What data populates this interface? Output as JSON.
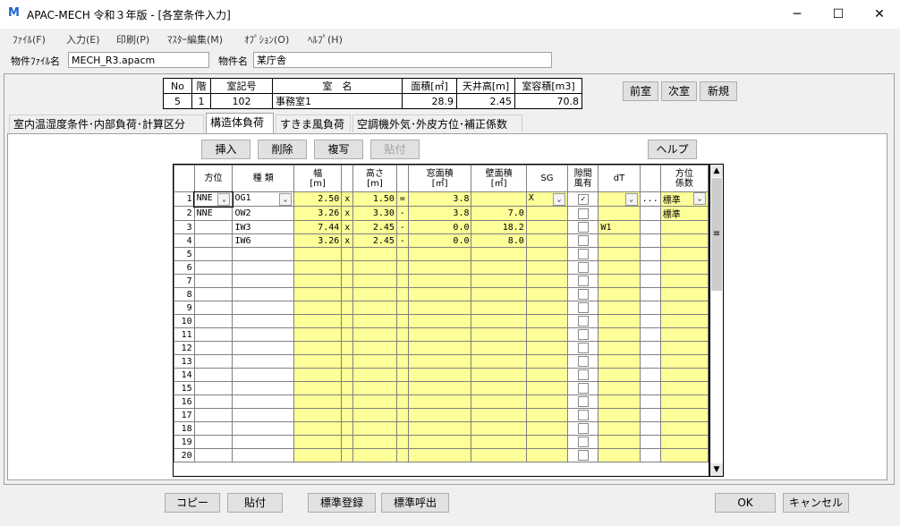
{
  "window": {
    "icon": "M",
    "title": "APAC-MECH 令和３年版 - [各室条件入力]",
    "minimize": "─",
    "maximize": "☐",
    "close": "✕"
  },
  "menu": [
    "ﾌｧｲﾙ(F)",
    "入力(E)",
    "印刷(P)",
    "ﾏｽﾀｰ編集(M)",
    "ｵﾌﾟｼｮﾝ(O)",
    "ﾍﾙﾌﾟ(H)"
  ],
  "file": {
    "file_label": "物件ﾌｧｲﾙ名",
    "file_value": "MECH_R3.apacm",
    "name_label": "物件名",
    "name_value": "某庁舎"
  },
  "room_info": {
    "headers": [
      "No",
      "階",
      "室記号",
      "室　名",
      "面積[㎡]",
      "天井高[m]",
      "室容積[m3]"
    ],
    "values": [
      "5",
      "1",
      "102",
      "事務室1",
      "28.9",
      "2.45",
      "70.8"
    ]
  },
  "room_buttons": {
    "prev": "前室",
    "next": "次室",
    "new": "新規"
  },
  "tabs": [
    "室内温湿度条件･内部負荷･計算区分",
    "構造体負荷",
    "すきま風負荷",
    "空調機外気･外皮方位･補正係数"
  ],
  "active_tab": 1,
  "edit_buttons": {
    "insert": "挿入",
    "delete": "削除",
    "copy": "複写",
    "paste": "貼付",
    "help": "ヘルプ"
  },
  "grid": {
    "headers": [
      "方位",
      "種 類",
      "幅\n[m]",
      "",
      "高さ\n[m]",
      "",
      "窓面積\n[㎡]",
      "壁面積\n[㎡]",
      "SG",
      "隙間\n風有",
      "dT",
      "",
      "方位\n係数"
    ],
    "rows": [
      {
        "no": "1",
        "dir": "NNE",
        "type": "OG1",
        "w": "2.50",
        "op1": "x",
        "h": "1.50",
        "op2": "=",
        "win": "3.8",
        "wall": "",
        "sg": "X",
        "gap": "✓",
        "dt": "",
        "dots": "...",
        "coef": "標準"
      },
      {
        "no": "2",
        "dir": "NNE",
        "type": "OW2",
        "w": "3.26",
        "op1": "x",
        "h": "3.30",
        "op2": "-",
        "win": "3.8",
        "wall": "7.0",
        "sg": "",
        "gap": "",
        "dt": "",
        "dots": "",
        "coef": "標準"
      },
      {
        "no": "3",
        "dir": "",
        "type": "IW3",
        "w": "7.44",
        "op1": "x",
        "h": "2.45",
        "op2": "-",
        "win": "0.0",
        "wall": "18.2",
        "sg": "",
        "gap": "",
        "dt": "W1",
        "dots": "",
        "coef": ""
      },
      {
        "no": "4",
        "dir": "",
        "type": "IW6",
        "w": "3.26",
        "op1": "x",
        "h": "2.45",
        "op2": "-",
        "win": "0.0",
        "wall": "8.0",
        "sg": "",
        "gap": "",
        "dt": "",
        "dots": "",
        "coef": ""
      },
      {
        "no": "5"
      },
      {
        "no": "6"
      },
      {
        "no": "7"
      },
      {
        "no": "8"
      },
      {
        "no": "9"
      },
      {
        "no": "10"
      },
      {
        "no": "11"
      },
      {
        "no": "12"
      },
      {
        "no": "13"
      },
      {
        "no": "14"
      },
      {
        "no": "15"
      },
      {
        "no": "16"
      },
      {
        "no": "17"
      },
      {
        "no": "18"
      },
      {
        "no": "19"
      },
      {
        "no": "20"
      }
    ]
  },
  "scrollbar": {
    "up": "▲",
    "down": "▼",
    "thumb": "≡"
  },
  "footer": {
    "copy": "コピー",
    "paste": "貼付",
    "std_register": "標準登録",
    "std_recall": "標準呼出",
    "ok": "OK",
    "cancel": "キャンセル"
  },
  "colors": {
    "editable": "#ffff99",
    "checked_mark": "✓"
  }
}
